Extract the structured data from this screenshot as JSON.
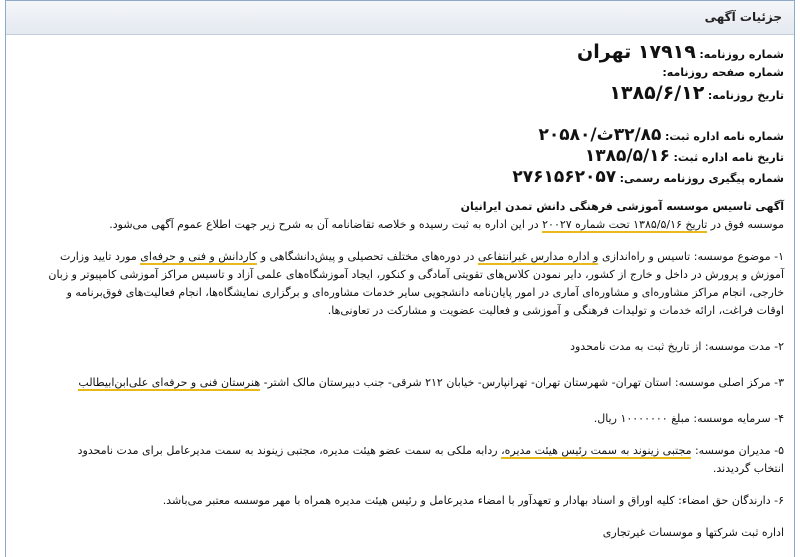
{
  "header": {
    "title": "جزئیات آگهی"
  },
  "newspaper": {
    "number_label": "شماره روزنامه:",
    "number_value": "۱۷۹۱۹ تهران",
    "page_label": "شماره صفحه روزنامه:",
    "date_label": "تاریخ روزنامه:",
    "date_value": "۱۳۸۵/۶/۱۲"
  },
  "registration": {
    "letter_label": "شماره نامه اداره ثبت:",
    "letter_value": "۳۲/۸۵ث/۲۰۵۸۰",
    "letter_date_label": "تاریخ نامه اداره ثبت:",
    "letter_date_value": "۱۳۸۵/۵/۱۶",
    "tracking_label": "شماره پیگیری روزنامه رسمی:",
    "tracking_value": "۲۷۶۱۵۶۲۰۵۷"
  },
  "notice": {
    "title": "آگهی تاسیس موسسه آموزشی فرهنگی دانش تمدن ایرانیان",
    "intro_a": "موسسه فوق در ",
    "intro_b": "تاریخ ۱۳۸۵/۵/۱۶ تحت شماره ۲۰۰۲۷",
    "intro_c": " در این اداره به ثبت رسیده و خلاصه تقاضانامه آن به شرح زیر جهت اطلاع عموم آگهی می‌شود.",
    "p1_a": "۱- موضوع موسسه: تاسیس و راه‌اندازی ",
    "p1_b": "و اداره مدارس غیرانتفاعی",
    "p1_c": " در دوره‌های مختلف تحصیلی و پیش‌دانشگاهی و ",
    "p1_d": "کاردانش و فنی و حرفه‌ای",
    "p1_e": " مورد تایید وزارت",
    "p1_line2": "آموزش و پرورش در داخل و خارج از کشور، دایر نمودن کلاس‌های تقویتی آمادگی و کنکور، ایجاد آموزشگاه‌های علمی آزاد و تاسیس مراکز آموزشی کامپیوتر و زبان",
    "p1_line3": "خارجی، انجام مراکز مشاوره‌ای و مشاوره‌ای آماری در امور پایان‌نامه دانشجویی سایر خدمات مشاوره‌ای و برگزاری نمایشگاه‌ها، انجام فعالیت‌های فوق‌برنامه و",
    "p1_line4": "اوقات فراغت، ارائه خدمات و تولیدات فرهنگی و آموزشی و فعالیت عضویت و مشارکت در تعاونی‌ها.",
    "p2": "۲- مدت موسسه: از تاریخ ثبت به مدت نامحدود",
    "p3_a": "۳- مرکز اصلی موسسه: استان تهران- شهرستان تهران- تهرانپارس- خیابان ۲۱۲ شرقی- جنب دبیرستان مالک اشتر- ",
    "p3_b": "هنرستان فنی و حرفه‌ای علی‌ابن‌ابیطالب",
    "p4": "۴- سرمایه موسسه: مبلغ ۱۰۰۰۰۰۰۰ ریال.",
    "p5_a": "۵- مدیران موسسه: ",
    "p5_b": "مجتبی زینوند به سمت رئیس هیئت مدیره،",
    "p5_c": " ردابه ملکی به سمت عضو هیئت مدیره، مجتبی زینوند به سمت مدیرعامل برای مدت نامحدود",
    "p5_line2": "انتخاب گردیدند.",
    "p6": "۶- دارندگان حق امضاء: کلیه اوراق و اسناد بهادار و تعهدآور با امضاء مدیرعامل و رئیس هیئت مدیره همراه با مهر موسسه معتبر می‌باشد.",
    "footer": "اداره ثبت شرکتها و موسسات غیرتجاری"
  }
}
